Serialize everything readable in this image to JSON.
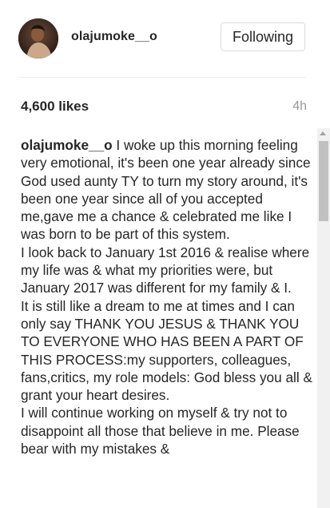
{
  "post": {
    "username": "olajumoke__o",
    "follow_label": "Following",
    "likes": "4,600 likes",
    "time": "4h"
  },
  "caption": {
    "author": "olajumoke__o",
    "paragraphs": [
      "I woke up this morning feeling very emotional, it's been one year already since God used aunty TY to turn my story around, it's been one year since all of you accepted me,gave me a chance & celebrated me like I was born to be part of this system.",
      "I look back to January 1st 2016 & realise where my life was & what my priorities were, but January 2017 was different for my family & I.",
      "It is still like a dream to me at times and I can only say THANK YOU JESUS & THANK YOU TO EVERYONE WHO HAS BEEN A PART OF THIS PROCESS:my supporters, colleagues, fans,critics, my role models: God bless you all & grant your heart desires.",
      "I will continue working on myself & try not to disappoint all those that believe in me. Please bear with my mistakes &"
    ]
  },
  "icons": {
    "avatar": "profile-photo",
    "scroll_up": "chevron-up-icon"
  },
  "colors": {
    "text": "#262626",
    "muted": "#999999",
    "border": "#dbdbdb"
  }
}
